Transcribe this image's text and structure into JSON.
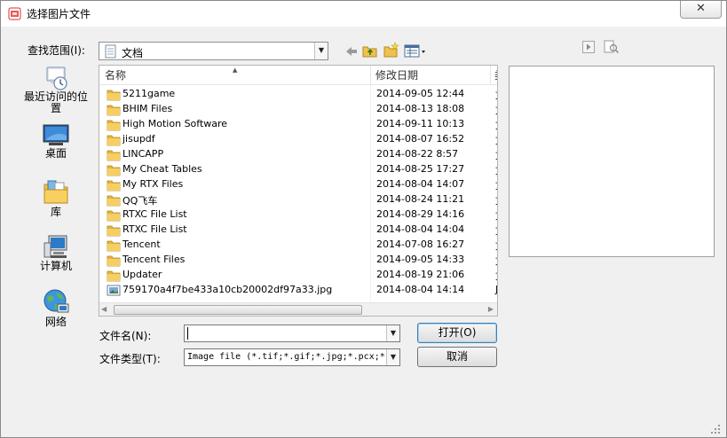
{
  "window": {
    "title": "选择图片文件",
    "close_glyph": "✕"
  },
  "lookin": {
    "label": "查找范围(I):",
    "value": "文档"
  },
  "places": [
    {
      "label": "最近访问的位置",
      "icon": "recent-places-icon"
    },
    {
      "label": "桌面",
      "icon": "desktop-icon"
    },
    {
      "label": "库",
      "icon": "libraries-icon"
    },
    {
      "label": "计算机",
      "icon": "computer-icon"
    },
    {
      "label": "网络",
      "icon": "network-icon"
    }
  ],
  "columns": {
    "name": "名称",
    "date": "修改日期",
    "more": "类"
  },
  "files": [
    {
      "name": "5211game",
      "date": "2014-09-05 12:44",
      "extra": "文",
      "kind": "folder"
    },
    {
      "name": "BHIM Files",
      "date": "2014-08-13 18:08",
      "extra": "文",
      "kind": "folder"
    },
    {
      "name": "High Motion Software",
      "date": "2014-09-11 10:13",
      "extra": "文",
      "kind": "folder"
    },
    {
      "name": "jisupdf",
      "date": "2014-08-07 16:52",
      "extra": "文",
      "kind": "folder"
    },
    {
      "name": "LINCAPP",
      "date": "2014-08-22 8:57",
      "extra": "文",
      "kind": "folder"
    },
    {
      "name": "My Cheat Tables",
      "date": "2014-08-25 17:27",
      "extra": "文",
      "kind": "folder"
    },
    {
      "name": "My RTX Files",
      "date": "2014-08-04 14:07",
      "extra": "文",
      "kind": "folder"
    },
    {
      "name": "QQ飞车",
      "date": "2014-08-24 11:21",
      "extra": "文",
      "kind": "folder"
    },
    {
      "name": "RTXC File List",
      "date": "2014-08-29 14:16",
      "extra": "文",
      "kind": "folder"
    },
    {
      "name": "RTXC File List",
      "date": "2014-08-04 14:04",
      "extra": "文",
      "kind": "folder"
    },
    {
      "name": "Tencent",
      "date": "2014-07-08 16:27",
      "extra": "文",
      "kind": "folder"
    },
    {
      "name": "Tencent Files",
      "date": "2014-09-05 14:33",
      "extra": "文",
      "kind": "folder"
    },
    {
      "name": "Updater",
      "date": "2014-08-19 21:06",
      "extra": "文",
      "kind": "folder"
    },
    {
      "name": "759170a4f7be433a10cb20002df97a33.jpg",
      "date": "2014-08-04 14:14",
      "extra": "J",
      "kind": "image"
    }
  ],
  "filename": {
    "label": "文件名(N):",
    "value": ""
  },
  "filetype": {
    "label": "文件类型(T):",
    "value": "Image file (*.tif;*.gif;*.jpg;*.pcx;*."
  },
  "buttons": {
    "open": "打开(O)",
    "cancel": "取消"
  },
  "colors": {
    "folder": "#e8b33a",
    "accent": "#3c7fb1"
  }
}
